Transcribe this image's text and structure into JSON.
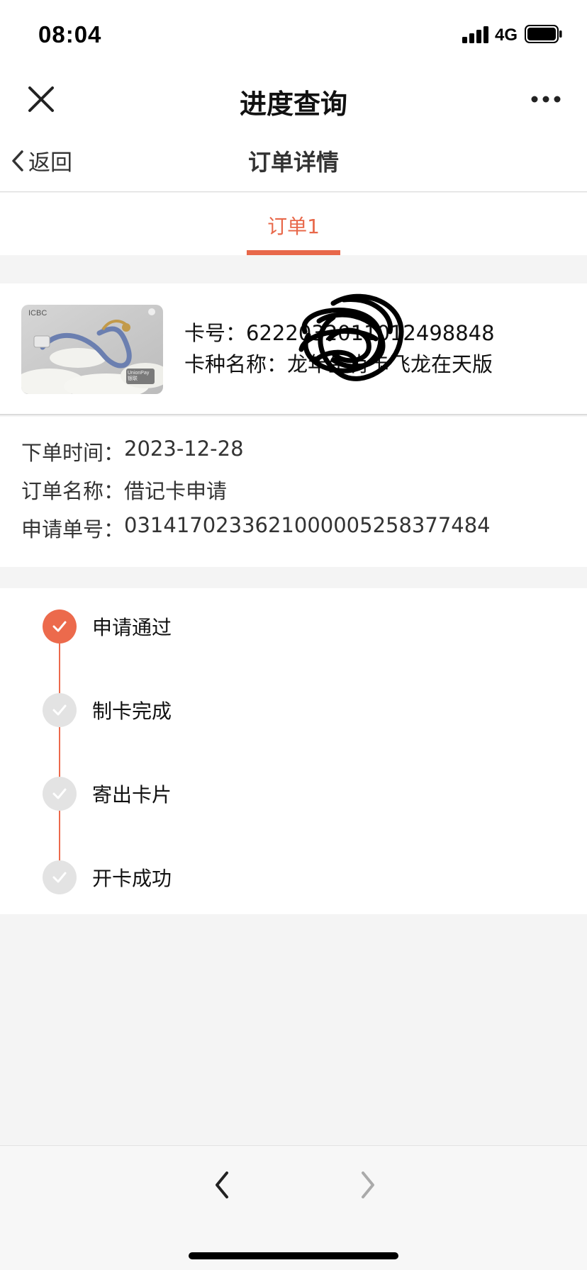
{
  "status_bar": {
    "time": "08:04",
    "network": "4G",
    "icons": [
      "signal-icon",
      "battery-icon"
    ]
  },
  "wx_header": {
    "title": "进度查询",
    "close_icon": "close-icon",
    "more_icon": "more-icon"
  },
  "nav": {
    "back_label": "返回",
    "title": "订单详情"
  },
  "tabs": [
    {
      "label": "订单1",
      "active": true
    }
  ],
  "card": {
    "number_label": "卡号：",
    "number_value": "6222032011012498848",
    "type_label": "卡种名称：",
    "type_value": "龙年生肖卡飞龙在天版",
    "brand_text": "ICBC",
    "union_text": "UnionPay 银联"
  },
  "order": {
    "rows": [
      {
        "label": "下单时间：",
        "value": "2023-12-28"
      },
      {
        "label": "订单名称：",
        "value": "借记卡申请"
      },
      {
        "label": "申请单号：",
        "value": "0314170233621000005258377484"
      }
    ]
  },
  "progress": {
    "steps": [
      {
        "label": "申请通过",
        "status": "done"
      },
      {
        "label": "制卡完成",
        "status": "pending"
      },
      {
        "label": "寄出卡片",
        "status": "pending"
      },
      {
        "label": "开卡成功",
        "status": "pending"
      }
    ]
  },
  "colors": {
    "accent": "#ec6a4c",
    "pending": "#e3e3e3"
  }
}
